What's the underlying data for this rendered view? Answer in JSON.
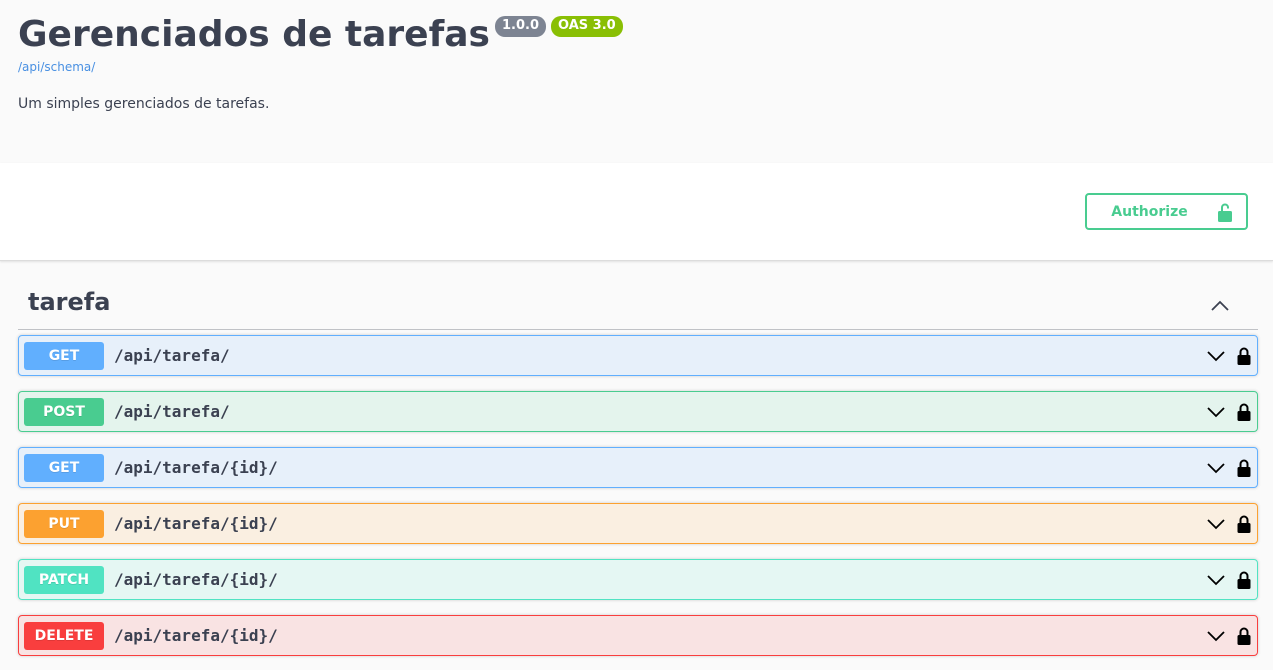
{
  "info": {
    "title": "Gerenciados de tarefas",
    "version": "1.0.0",
    "oas": "OAS 3.0",
    "schema_link": "/api/schema/",
    "description": "Um simples gerenciados de tarefas."
  },
  "auth": {
    "authorize_label": "Authorize",
    "icon": "unlock-icon"
  },
  "tag": {
    "name": "tarefa",
    "icon": "chevron-up-icon"
  },
  "operations": [
    {
      "method": "GET",
      "path": "/api/tarefa/"
    },
    {
      "method": "POST",
      "path": "/api/tarefa/"
    },
    {
      "method": "GET",
      "path": "/api/tarefa/{id}/"
    },
    {
      "method": "PUT",
      "path": "/api/tarefa/{id}/"
    },
    {
      "method": "PATCH",
      "path": "/api/tarefa/{id}/"
    },
    {
      "method": "DELETE",
      "path": "/api/tarefa/{id}/"
    }
  ],
  "colors": {
    "get": "#61affe",
    "post": "#49cc90",
    "put": "#fca130",
    "patch": "#50e3c2",
    "delete": "#f93e3e",
    "authorize": "#49cc90"
  }
}
